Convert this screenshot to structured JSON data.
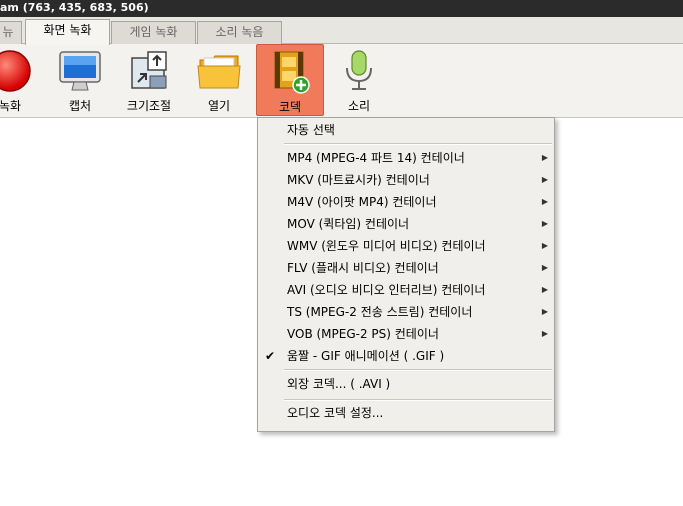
{
  "window": {
    "title": "am (763, 435, 683, 506)"
  },
  "tabs": [
    {
      "label": "뉴"
    },
    {
      "label": "화면 녹화"
    },
    {
      "label": "게임 녹화"
    },
    {
      "label": "소리 녹음"
    }
  ],
  "toolbar": {
    "items": [
      {
        "label": "녹화",
        "icon": "record-icon"
      },
      {
        "label": "캡처",
        "icon": "monitor-icon"
      },
      {
        "label": "크기조절",
        "icon": "resize-icon"
      },
      {
        "label": "열기",
        "icon": "folder-icon"
      },
      {
        "label": "코덱",
        "icon": "film-add-icon"
      },
      {
        "label": "소리",
        "icon": "microphone-icon"
      }
    ]
  },
  "codec_menu": {
    "auto": "자동 선택",
    "containers": [
      "MP4 (MPEG-4 파트 14) 컨테이너",
      "MKV (마트료시카) 컨테이너",
      "M4V (아이팟 MP4) 컨테이너",
      "MOV (퀵타임) 컨테이너",
      "WMV (윈도우 미디어 비디오) 컨테이너",
      "FLV (플래시 비디오) 컨테이너",
      "AVI (오디오 비디오 인터리브) 컨테이너",
      "TS (MPEG-2 전송 스트림) 컨테이너",
      "VOB (MPEG-2 PS) 컨테이너"
    ],
    "gif": "움짤 - GIF 애니메이션 ( .GIF )",
    "gif_checked": "✔",
    "external": "외장 코덱... ( .AVI )",
    "audio": "오디오 코덱 설정...",
    "submenu_arrow": "▶"
  },
  "colors": {
    "selected_tool": "#f07a5a",
    "titlebar": "#2b2b2b"
  }
}
